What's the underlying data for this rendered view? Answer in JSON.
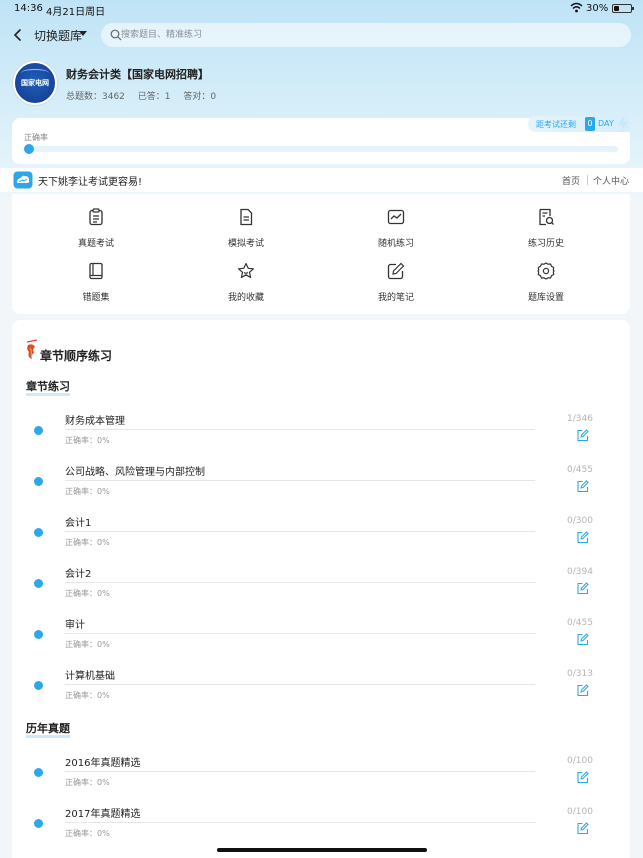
{
  "status_bar": {
    "time": "14:36",
    "date": "4月21日周日",
    "battery": "30%"
  },
  "nav": {
    "switch_label": "切换题库",
    "search_placeholder": "搜索题目、精准练习"
  },
  "bank": {
    "logo_text": "国家电网",
    "title": "财务会计类【国家电网招聘】",
    "total": "总题数：3462",
    "answered": "已答：1",
    "correct": "答对：0"
  },
  "accuracy": {
    "label": "正确率",
    "fraction": 0.0
  },
  "countdown": {
    "label": "距考试还剩",
    "days": "0",
    "unit": "DAY"
  },
  "slogan": {
    "text": "天下姚李让考试更容易!",
    "home": "首页",
    "center": "个人中心"
  },
  "menu": [
    {
      "label": "真题考试",
      "icon": "clipboard-icon"
    },
    {
      "label": "模拟考试",
      "icon": "document-icon"
    },
    {
      "label": "随机练习",
      "icon": "chart-icon"
    },
    {
      "label": "练习历史",
      "icon": "history-icon"
    },
    {
      "label": "错题集",
      "icon": "book-icon"
    },
    {
      "label": "我的收藏",
      "icon": "star-icon"
    },
    {
      "label": "我的笔记",
      "icon": "note-edit-icon"
    },
    {
      "label": "题库设置",
      "icon": "gear-icon"
    }
  ],
  "chapters": {
    "heading": "章节顺序练习",
    "groups": [
      {
        "title": "章节练习",
        "items": [
          {
            "name": "财务成本管理",
            "accuracy": "正确率：0%",
            "count": "1/346"
          },
          {
            "name": "公司战略、风险管理与内部控制",
            "accuracy": "正确率：0%",
            "count": "0/455"
          },
          {
            "name": "会计1",
            "accuracy": "正确率：0%",
            "count": "0/300"
          },
          {
            "name": "会计2",
            "accuracy": "正确率：0%",
            "count": "0/394"
          },
          {
            "name": "审计",
            "accuracy": "正确率：0%",
            "count": "0/455"
          },
          {
            "name": "计算机基础",
            "accuracy": "正确率：0%",
            "count": "0/313"
          }
        ]
      },
      {
        "title": "历年真题",
        "items": [
          {
            "name": "2016年真题精选",
            "accuracy": "正确率：0%",
            "count": "0/100"
          },
          {
            "name": "2017年真题精选",
            "accuracy": "正确率：0%",
            "count": "0/100"
          }
        ]
      }
    ]
  },
  "colors": {
    "accent": "#2ea6ea",
    "hero_top": "#bfe3f6"
  }
}
